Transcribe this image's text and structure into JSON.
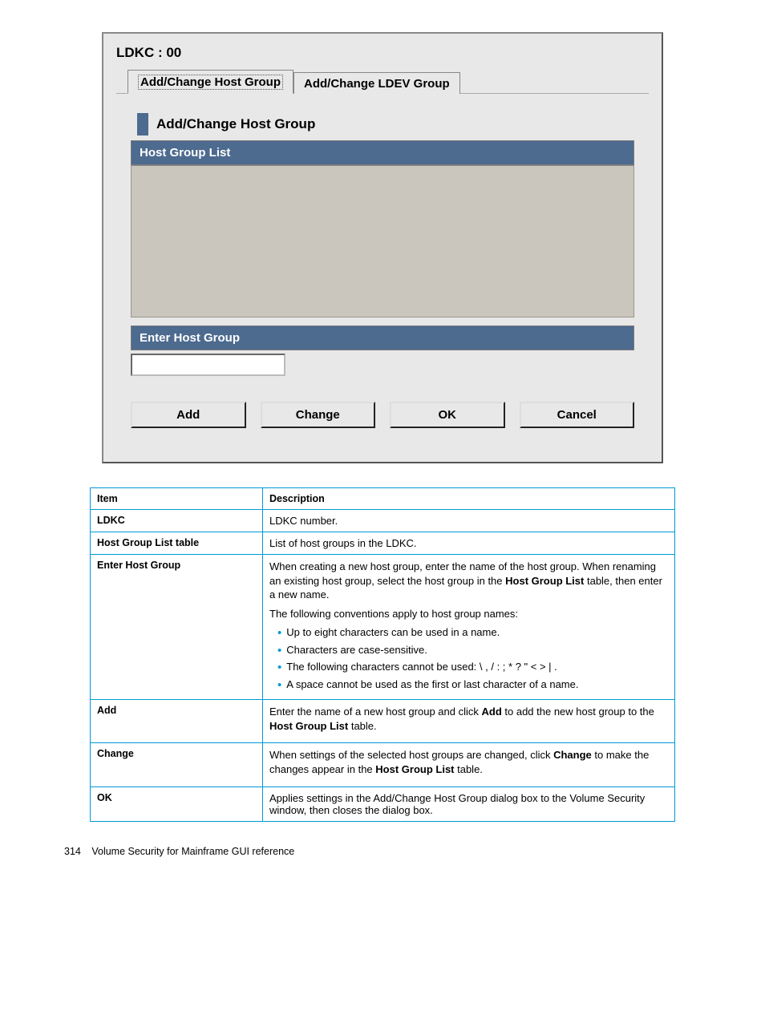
{
  "dialog": {
    "ldkc_label": "LDKC : 00",
    "tabs": {
      "hostgroup": "Add/Change Host Group",
      "ldevgroup": "Add/Change LDEV Group"
    },
    "section_title": "Add/Change Host Group",
    "hostgroup_list_label": "Host Group List",
    "enter_hostgroup_label": "Enter Host Group",
    "input_value": "",
    "buttons": {
      "add": "Add",
      "change": "Change",
      "ok": "OK",
      "cancel": "Cancel"
    }
  },
  "table": {
    "headers": {
      "item": "Item",
      "desc": "Description"
    },
    "rows": {
      "ldkc": {
        "item": "LDKC",
        "desc": "LDKC number."
      },
      "hglist": {
        "item": "Host Group List table",
        "desc": "List of host groups in the LDKC."
      },
      "enterhg": {
        "item": "Enter Host Group",
        "p1a": "When creating a new host group, enter the name of the host group. When renaming an existing host group, select the host group in the ",
        "p1b": "Host Group List",
        "p1c": " table, then enter a new name.",
        "p2": "The following conventions apply to host group names:",
        "b1": "Up to eight characters can be used in a name.",
        "b2": "Characters are case-sensitive.",
        "b3": "The following characters cannot be used: \\ , / : ; * ? \" < > | .",
        "b4": "A space cannot be used as the first or last character of a name."
      },
      "add": {
        "item": "Add",
        "a": "Enter the name of a new host group and click ",
        "b": "Add",
        "c": " to add the new host group to the ",
        "d": "Host Group List",
        "e": " table."
      },
      "change": {
        "item": "Change",
        "a": "When settings of the selected host groups are changed, click ",
        "b": "Change",
        "c": " to make the changes appear in the ",
        "d": "Host Group List",
        "e": " table."
      },
      "ok": {
        "item": "OK",
        "desc": "Applies settings in the Add/Change Host Group dialog box to the Volume Security window, then closes the dialog box."
      }
    }
  },
  "footer": {
    "page": "314",
    "title": "Volume Security for Mainframe GUI reference"
  }
}
